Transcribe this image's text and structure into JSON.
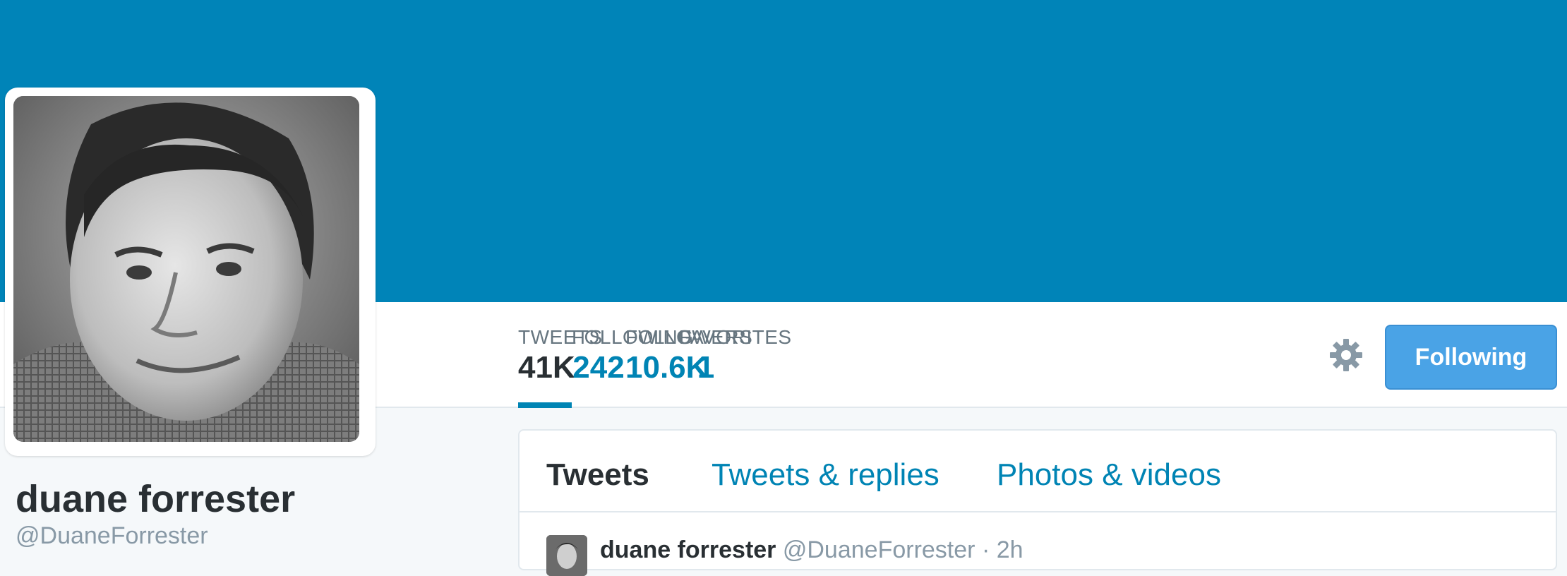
{
  "profile": {
    "name": "duane forrester",
    "handle": "@DuaneForrester"
  },
  "stats": [
    {
      "label": "TWEETS",
      "value": "41K"
    },
    {
      "label": "FOLLOWING",
      "value": "242"
    },
    {
      "label": "FOLLOWERS",
      "value": "10.6K"
    },
    {
      "label": "FAVORITES",
      "value": "1"
    }
  ],
  "actions": {
    "follow_label": "Following",
    "settings_icon": "gear-icon"
  },
  "timeline": {
    "tabs": [
      {
        "label": "Tweets"
      },
      {
        "label": "Tweets & replies"
      },
      {
        "label": "Photos & videos"
      }
    ],
    "tweet": {
      "name": "duane forrester",
      "handle": "@DuaneForrester",
      "separator": "·",
      "time": "2h"
    }
  },
  "colors": {
    "banner": "#0084b8",
    "accent": "#0084b4",
    "button": "#4aa3e6"
  }
}
